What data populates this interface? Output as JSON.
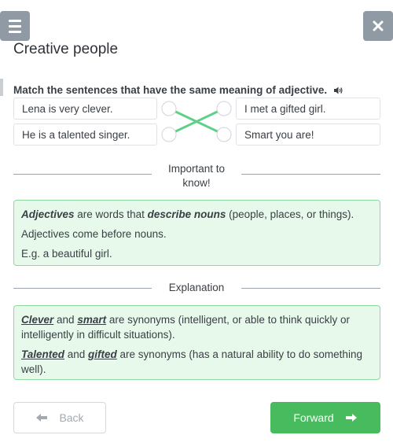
{
  "header": {
    "menu_icon": "hamburger-menu-icon",
    "close_icon": "close-x-icon",
    "title": "Creative people"
  },
  "exercise": {
    "instruction": "Match the sentences that have the same meaning of adjective.",
    "audio_icon": "speaker-icon",
    "left_items": [
      "Lena is very clever.",
      "He is a talented singer."
    ],
    "right_items": [
      "I met a gifted girl.",
      "Smart you are!"
    ],
    "matches": [
      [
        0,
        1
      ],
      [
        1,
        0
      ]
    ]
  },
  "important": {
    "heading": "Important to know!",
    "segments": [
      {
        "text": "Adjectives",
        "style": "bi"
      },
      {
        "text": " are words that ",
        "style": ""
      },
      {
        "text": "describe nouns",
        "style": "bi"
      },
      {
        "text": " (people, places, or things).",
        "style": ""
      }
    ],
    "line2": "Adjectives come before nouns.",
    "line3": "E.g. a beautiful girl."
  },
  "explanation": {
    "heading": "Explanation",
    "p1": [
      {
        "text": "Clever",
        "style": "bu"
      },
      {
        "text": " and ",
        "style": ""
      },
      {
        "text": "smart",
        "style": "bu"
      },
      {
        "text": " are synonyms (intelligent, or able to think quickly or intelligently in difficult situations).",
        "style": ""
      }
    ],
    "p2": [
      {
        "text": "Talented",
        "style": "bu"
      },
      {
        "text": " and ",
        "style": ""
      },
      {
        "text": "gifted",
        "style": "bu"
      },
      {
        "text": " are synonyms (has a natural ability to do something well).",
        "style": ""
      }
    ]
  },
  "nav": {
    "back_label": "Back",
    "forward_label": "Forward",
    "back_icon": "arrow-left-icon",
    "forward_icon": "arrow-right-icon"
  },
  "colors": {
    "green_accent": "#48bb5e",
    "info_bg": "#e6f9ea",
    "info_border": "#8fd9a0",
    "match_line": "#5fd08a",
    "header_button": "#8f9aa5"
  }
}
